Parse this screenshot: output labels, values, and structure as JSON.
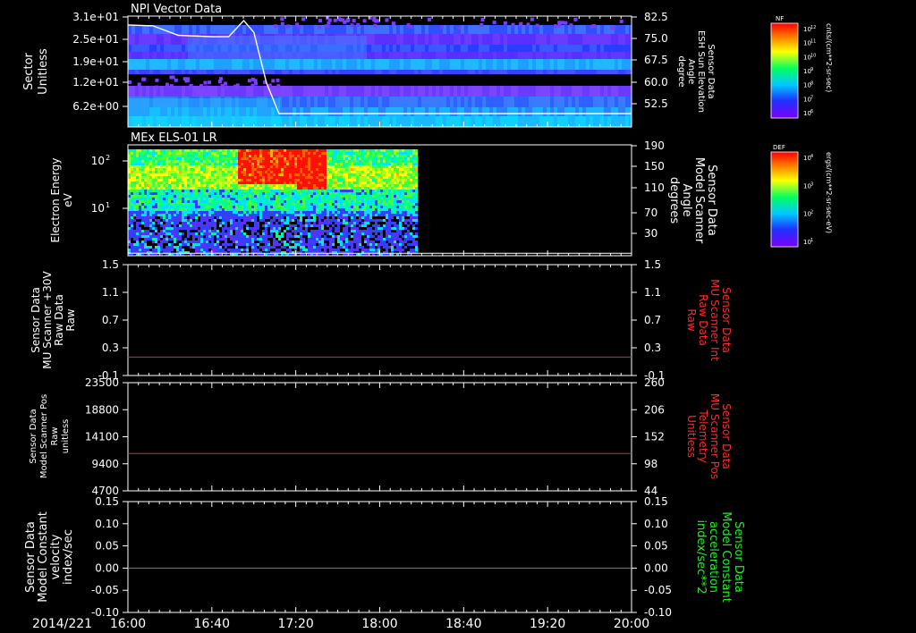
{
  "date_label": "2014/221",
  "time_ticks": [
    "16:00",
    "16:40",
    "17:20",
    "18:00",
    "18:40",
    "19:20",
    "20:00"
  ],
  "colors": {
    "red_axis": "#ff2a2a",
    "green_axis": "#22ee22",
    "trace_red": "#cc3333",
    "trace_green": "#22bb22"
  },
  "chart_data": [
    {
      "type": "heatmap",
      "title": "NPI Vector Data",
      "ylabel": "Sector Unitless",
      "yticks": [
        "3.1e+01",
        "2.5e+01",
        "1.9e+01",
        "1.2e+01",
        "6.2e+00"
      ],
      "y2label": "Sensor Data ESH Sun Elevation Angle degree",
      "y2ticks": [
        "82.5",
        "75.0",
        "67.5",
        "60.0",
        "52.5"
      ],
      "y2lim": [
        45,
        82.5
      ],
      "overlay_line": {
        "x_hours": [
          16.0,
          16.2,
          16.4,
          16.67,
          16.8,
          16.92,
          17.0,
          17.1,
          17.2,
          17.5,
          18.0,
          19.0,
          20.0
        ],
        "y": [
          79.5,
          79.2,
          76.0,
          75.5,
          75.5,
          81.0,
          77.0,
          60.0,
          49.5,
          49.5,
          49.5,
          49.5,
          49.5
        ]
      },
      "colorbar": {
        "label": "NF",
        "units": "cnts/(cm**2-sr-sec)",
        "ticks": [
          "10^12",
          "10^11",
          "10^10",
          "10^9",
          "10^8",
          "10^7",
          "10^6"
        ]
      }
    },
    {
      "type": "heatmap",
      "title": "MEx ELS-01 LR",
      "ylabel": "Electron Energy eV",
      "yticks": [
        "10^2",
        "10^1"
      ],
      "y2label": "Sensor Data Model Scanner Angle degrees",
      "y2ticks": [
        "190",
        "150",
        "110",
        "70",
        "30"
      ],
      "y2lim": [
        10,
        190
      ],
      "data_end_hours": 18.3,
      "overlay_line": {
        "x_hours": [
          16.0,
          20.0
        ],
        "y": [
          14,
          14
        ]
      },
      "colorbar": {
        "label": "DEF",
        "units": "ergs/(cm**2-sr-sec-eV)",
        "ticks": [
          "10^4",
          "10^3",
          "10^2",
          "10^1"
        ]
      }
    },
    {
      "type": "line",
      "ylabel": "Sensor Data MU Scanner +30V Raw Data Raw",
      "yticks": [
        "1.5",
        "1.1",
        "0.7",
        "0.3",
        "-0.1"
      ],
      "ylim": [
        -0.3,
        1.5
      ],
      "y2label": "Sensor Data MU Scanner Int Raw Data Raw",
      "y2ticks": [
        "1.5",
        "1.1",
        "0.7",
        "0.3",
        "-0.1"
      ],
      "series": [
        {
          "x_hours": [
            16.0,
            20.0
          ],
          "values": [
            0.0,
            0.0
          ]
        }
      ]
    },
    {
      "type": "line",
      "ylabel": "Sensor Data Model Scanner Pos Raw unitless",
      "yticks": [
        "23500",
        "18800",
        "14100",
        "9400",
        "4700"
      ],
      "ylim": [
        0,
        23500
      ],
      "y2label": "Sensor Data MU Scanner Pos Telemetry Unitless",
      "y2ticks": [
        "260",
        "206",
        "152",
        "98",
        "44"
      ],
      "series": [
        {
          "x_hours": [
            16.0,
            20.0
          ],
          "values": [
            8100,
            8100
          ]
        }
      ]
    },
    {
      "type": "line",
      "ylabel": "Sensor Data Model Constant velocity index/sec",
      "yticks": [
        "0.15",
        "0.10",
        "0.05",
        "0.00",
        "-0.05",
        "-0.10"
      ],
      "ylim": [
        -0.1,
        0.15
      ],
      "y2label": "Sensor Data Model Constant acceleration index/sec**2",
      "y2ticks": [
        "0.15",
        "0.10",
        "0.05",
        "0.00",
        "-0.05",
        "-0.10"
      ],
      "series": [
        {
          "x_hours": [
            16.0,
            20.0
          ],
          "values": [
            0.0,
            0.0
          ]
        }
      ]
    }
  ]
}
